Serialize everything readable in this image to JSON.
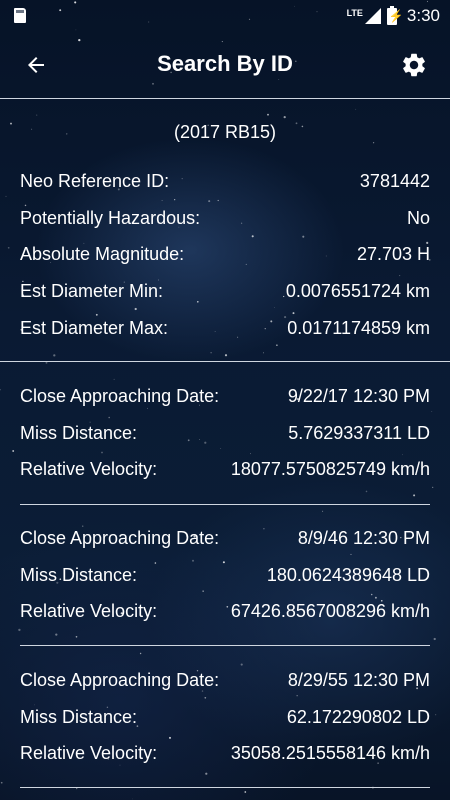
{
  "status_bar": {
    "network": "LTE",
    "time": "3:30"
  },
  "app_bar": {
    "title": "Search By ID"
  },
  "neo": {
    "name": "(2017 RB15)",
    "details": [
      {
        "label": "Neo Reference ID:",
        "value": "3781442"
      },
      {
        "label": "Potentially Hazardous:",
        "value": "No"
      },
      {
        "label": "Absolute Magnitude:",
        "value": "27.703 H"
      },
      {
        "label": "Est Diameter Min:",
        "value": "0.0076551724 km"
      },
      {
        "label": "Est Diameter Max:",
        "value": "0.0171174859 km"
      }
    ]
  },
  "approaches": [
    {
      "date_label": "Close Approaching Date:",
      "date": "9/22/17 12:30 PM",
      "miss_label": "Miss Distance:",
      "miss": "5.7629337311 LD",
      "velocity_label": "Relative Velocity:",
      "velocity": "18077.5750825749 km/h"
    },
    {
      "date_label": "Close Approaching Date:",
      "date": "8/9/46 12:30 PM",
      "miss_label": "Miss Distance:",
      "miss": "180.0624389648 LD",
      "velocity_label": "Relative Velocity:",
      "velocity": "67426.8567008296 km/h"
    },
    {
      "date_label": "Close Approaching Date:",
      "date": "8/29/55 12:30 PM",
      "miss_label": "Miss Distance:",
      "miss": "62.172290802 LD",
      "velocity_label": "Relative Velocity:",
      "velocity": "35058.2515558146 km/h"
    }
  ]
}
